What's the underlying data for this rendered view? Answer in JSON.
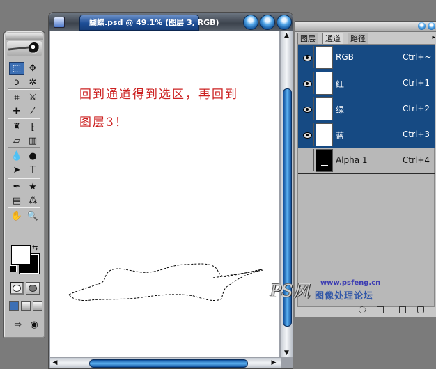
{
  "document": {
    "title": "蝴蝶.psd @ 49.1% (图层 3, RGB)",
    "instruction_line1": "回到通道得到选区，再回到",
    "instruction_line2": "图层3！"
  },
  "panel": {
    "tabs": [
      {
        "label": "图层",
        "active": false
      },
      {
        "label": "通道",
        "active": true
      },
      {
        "label": "路径",
        "active": false
      }
    ],
    "channels": [
      {
        "name": "RGB",
        "shortcut": "Ctrl+~",
        "selected": true,
        "visible": true,
        "thumbnail": "white"
      },
      {
        "name": "红",
        "shortcut": "Ctrl+1",
        "selected": true,
        "visible": true,
        "thumbnail": "white"
      },
      {
        "name": "绿",
        "shortcut": "Ctrl+2",
        "selected": true,
        "visible": true,
        "thumbnail": "white"
      },
      {
        "name": "蓝",
        "shortcut": "Ctrl+3",
        "selected": true,
        "visible": true,
        "thumbnail": "white"
      },
      {
        "name": "Alpha 1",
        "shortcut": "Ctrl+4",
        "selected": false,
        "visible": false,
        "thumbnail": "black"
      }
    ]
  },
  "toolbox": {
    "tools": [
      {
        "name": "marquee-tool",
        "glyph": "⬚",
        "selected": true
      },
      {
        "name": "move-tool",
        "glyph": "✥",
        "selected": false
      },
      {
        "name": "lasso-tool",
        "glyph": "ↄ",
        "selected": false
      },
      {
        "name": "magic-wand-tool",
        "glyph": "✲",
        "selected": false
      },
      {
        "name": "crop-tool",
        "glyph": "⌗",
        "selected": false
      },
      {
        "name": "slice-tool",
        "glyph": "⚔",
        "selected": false
      },
      {
        "name": "healing-brush-tool",
        "glyph": "✚",
        "selected": false
      },
      {
        "name": "brush-tool",
        "glyph": "⁄",
        "selected": false
      },
      {
        "name": "clone-stamp-tool",
        "glyph": "♜",
        "selected": false
      },
      {
        "name": "history-brush-tool",
        "glyph": "⁅",
        "selected": false
      },
      {
        "name": "eraser-tool",
        "glyph": "▱",
        "selected": false
      },
      {
        "name": "gradient-tool",
        "glyph": "▥",
        "selected": false
      },
      {
        "name": "blur-tool",
        "glyph": "💧",
        "selected": false
      },
      {
        "name": "dodge-tool",
        "glyph": "●",
        "selected": false
      },
      {
        "name": "path-selection-tool",
        "glyph": "➤",
        "selected": false
      },
      {
        "name": "type-tool",
        "glyph": "T",
        "selected": false
      },
      {
        "name": "pen-tool",
        "glyph": "✒",
        "selected": false
      },
      {
        "name": "custom-shape-tool",
        "glyph": "★",
        "selected": false
      },
      {
        "name": "notes-tool",
        "glyph": "▤",
        "selected": false
      },
      {
        "name": "eyedropper-tool",
        "glyph": "⁂",
        "selected": false
      },
      {
        "name": "hand-tool",
        "glyph": "✋",
        "selected": false
      },
      {
        "name": "zoom-tool",
        "glyph": "🔍",
        "selected": false
      }
    ],
    "foreground_color": "#ffffff",
    "background_color": "#000000"
  },
  "watermark": {
    "logo": "PS风",
    "url": "www.psfeng.cn",
    "name": "图像处理论坛"
  },
  "colors": {
    "selected_row": "#164a83",
    "text_red": "#cc2121"
  }
}
